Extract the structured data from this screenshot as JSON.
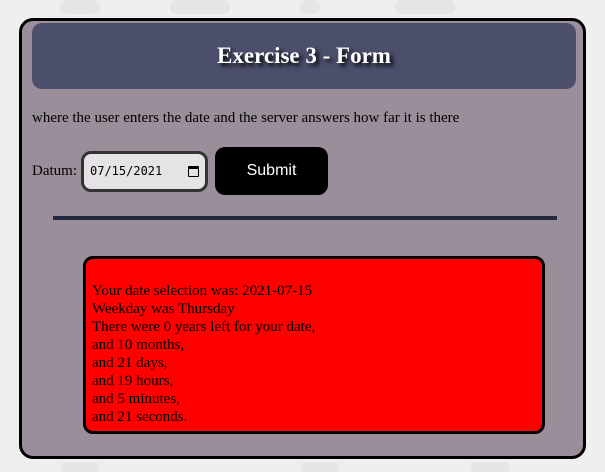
{
  "header": {
    "title": "Exercise 3 - Form"
  },
  "description": "where the user enters the date and the server answers how far it is there",
  "form": {
    "date_label": "Datum:",
    "date_value": "07/15/2021",
    "date_icon": "calendar-icon",
    "submit_label": "Submit"
  },
  "result": {
    "lines": [
      "Your date selection was: 2021-07-15",
      "Weekday was Thursday",
      "There were 0 years left for your date,",
      "and 10 months,",
      "and 21 days,",
      "and 19 hours,",
      "and 5 minutes,",
      "and 21 seconds."
    ]
  },
  "colors": {
    "card_bg": "#9a8e9b",
    "header_bg": "#4b4f6b",
    "result_bg": "#ff0000",
    "divider": "#24283f",
    "button_bg": "#000000"
  }
}
